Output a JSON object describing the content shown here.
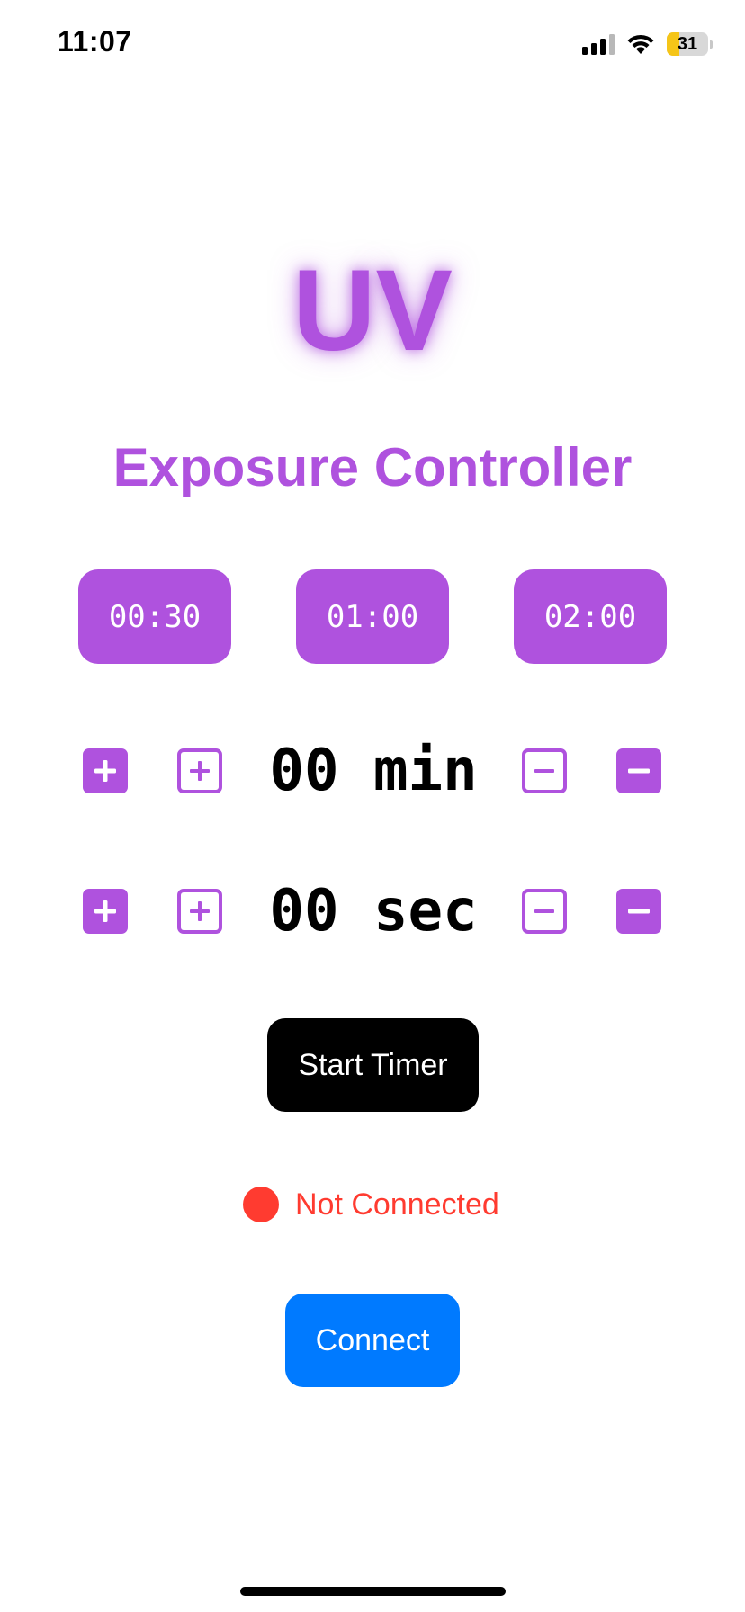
{
  "status_bar": {
    "time": "11:07",
    "battery_level": "31",
    "battery_fraction": 0.31,
    "icons": [
      "cellular-signal-icon",
      "wifi-icon",
      "battery-icon"
    ]
  },
  "header": {
    "logo_text": "UV",
    "subtitle": "Exposure Controller"
  },
  "presets": [
    "00:30",
    "01:00",
    "02:00"
  ],
  "timer": {
    "minutes_display": "00 min",
    "seconds_display": "00 sec",
    "step_icons": [
      "plus-filled-icon",
      "plus-outline-icon",
      "minus-outline-icon",
      "minus-filled-icon"
    ]
  },
  "actions": {
    "start_label": "Start Timer",
    "connect_label": "Connect"
  },
  "connection": {
    "status_text": "Not Connected"
  },
  "colors": {
    "accent": "#af52de",
    "status_error": "#ff3b30",
    "connect_button": "#007aff",
    "start_button": "#000000",
    "battery_low": "#f5c518"
  }
}
